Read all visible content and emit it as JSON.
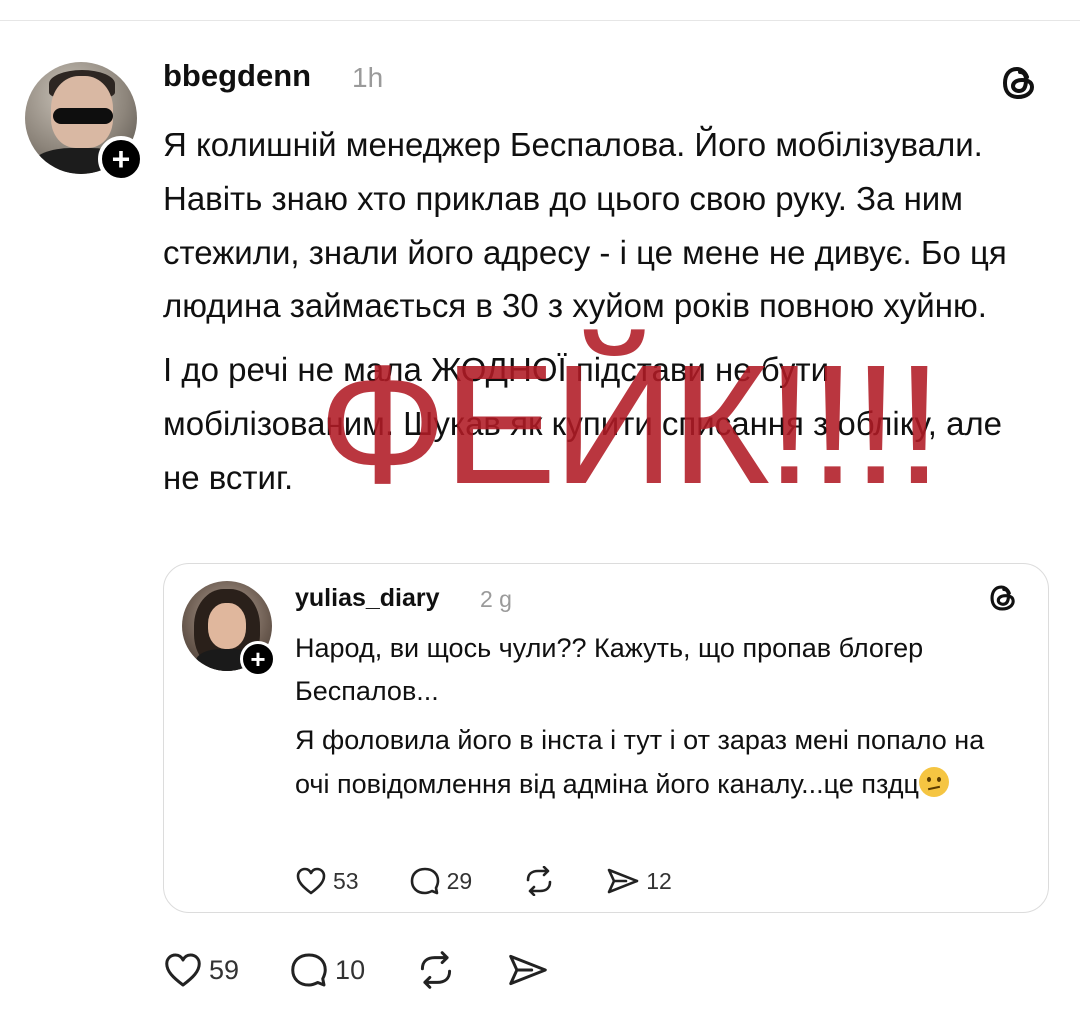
{
  "post": {
    "username": "bbegdenn",
    "time": "1h",
    "paragraphs": [
      "Я колишній менеджер Беспалова. Його мобілізували. Навіть знаю хто приклав до цього свою руку. За ним стежили, знали його адресу - і це мене не дивує. Бо ця людина займається в 30 з хуйом років повною хуйню.",
      "І до речі не мала ЖОДНОЇ підстави не бути мобілізованим. Шукав як купити списання з обліку, але не встиг."
    ],
    "stamp": "ФЕЙК!!!!",
    "actions": {
      "likes": "59",
      "comments": "10"
    }
  },
  "quote": {
    "username": "yulias_diary",
    "time": "2 g",
    "paragraphs": [
      "Народ, ви щось чули?? Кажуть, що пропав блогер Беспалов...",
      "Я фоловила його в інста і тут і от зараз мені попало на очі повідомлення від адміна його каналу...це пздц"
    ],
    "emoji": "confused-face",
    "actions": {
      "likes": "53",
      "comments": "29",
      "shares": "12"
    }
  },
  "colors": {
    "stamp": "#b01a24",
    "muted": "#9a9a9a"
  }
}
